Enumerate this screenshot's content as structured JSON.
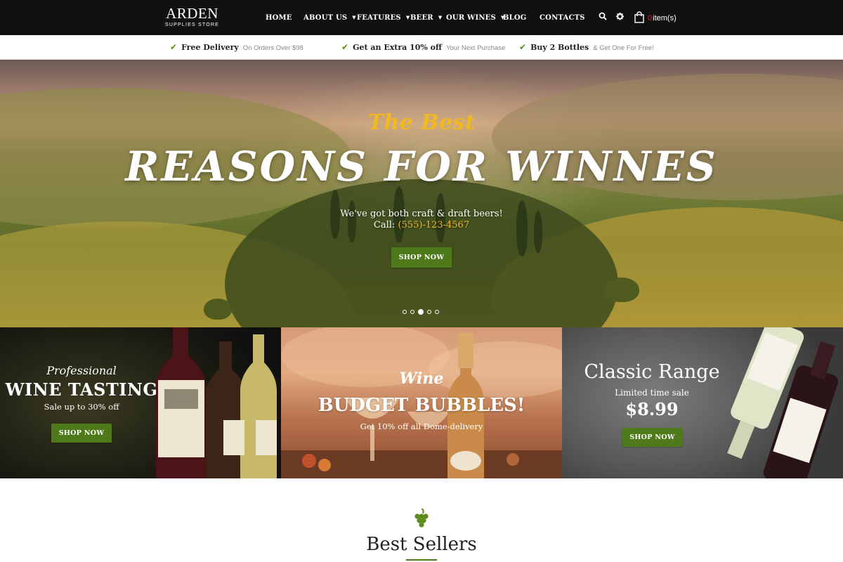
{
  "logo": {
    "name": "ARDEN",
    "tagline": "SUPPLIES STORE"
  },
  "nav": {
    "items": [
      {
        "label": "HOME",
        "dropdown": false
      },
      {
        "label": "ABOUT US",
        "dropdown": true
      },
      {
        "label": "FEATURES",
        "dropdown": true
      },
      {
        "label": "BEER",
        "dropdown": true
      },
      {
        "label": "OUR WINES",
        "dropdown": true
      },
      {
        "label": "BLOG",
        "dropdown": false
      },
      {
        "label": "CONTACTS",
        "dropdown": false
      }
    ],
    "icons": [
      "search-icon",
      "gear-icon",
      "shopping-bag-icon"
    ],
    "cart": {
      "count": "0",
      "label": "item(s)"
    }
  },
  "promo": [
    {
      "main": "Free Delivery",
      "sub": "On Orders Over $98"
    },
    {
      "main": "Get an Extra 10% off",
      "sub": "Your Next Purchase"
    },
    {
      "main": "Buy 2 Bottles",
      "sub": "& Get One For Free!"
    }
  ],
  "hero": {
    "kicker": "The Best",
    "title": "Reasons for winnes",
    "line1": "We've got both craft & draft beers!",
    "call_label": "Call:",
    "phone": "(555)-123-4567",
    "button": "SHOP NOW",
    "slides_total": 5,
    "slide_active": 3
  },
  "banners": [
    {
      "script": "Professional",
      "title": "WINE TASTING",
      "sub": "Sale up to 30% off",
      "button": "SHOP NOW"
    },
    {
      "script": "Wine",
      "title": "BUDGET BUBBLES!",
      "sub": "Get 10% off all Dome-delivery"
    },
    {
      "title": "Classic Range",
      "sub": "Limited time sale",
      "price": "$8.99",
      "button": "SHOP NOW"
    }
  ],
  "best_sellers": {
    "title": "Best Sellers"
  },
  "colors": {
    "accent_green": "#4e7a1c",
    "accent_gold": "#f2b820",
    "topbar": "#111111",
    "cart_count": "#e0242e"
  }
}
